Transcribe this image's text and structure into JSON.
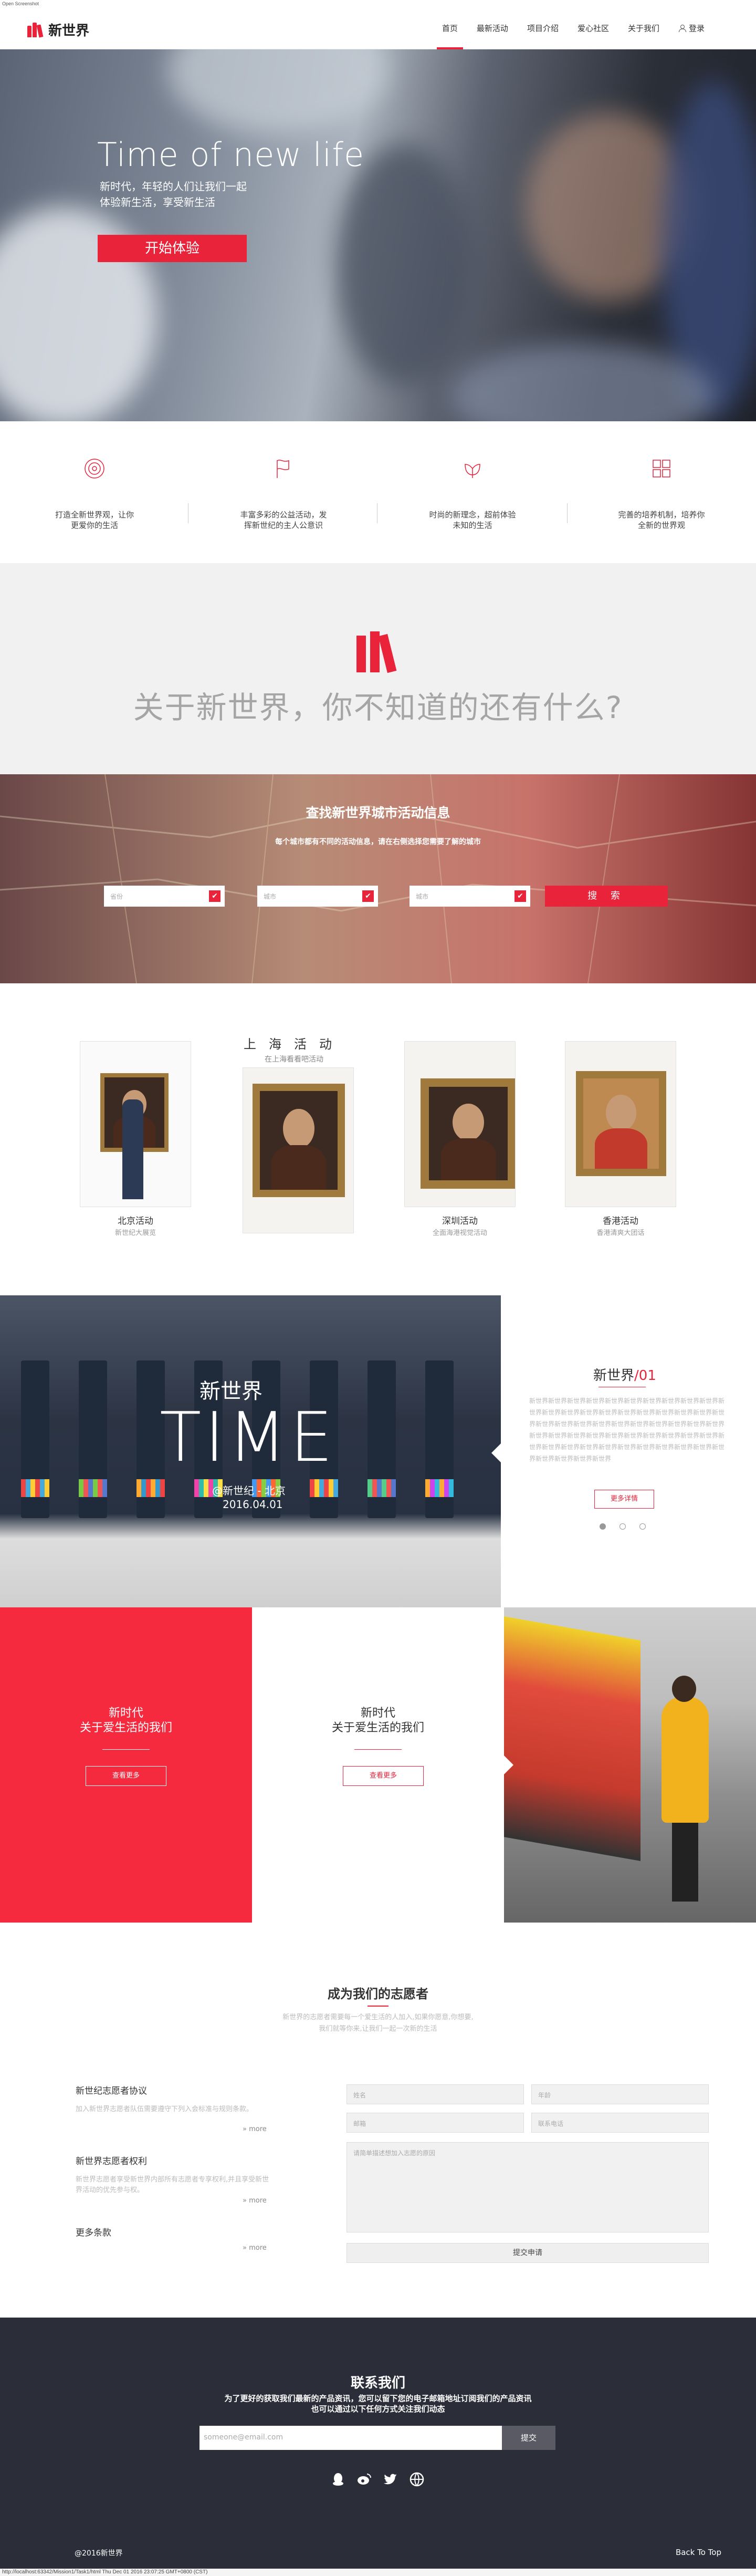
{
  "chrome": {
    "tab_title": "Open Screenshot",
    "status_bar": "http://localhost:63342/Mission1/Task1/html Thu Dec 01 2016 23:07:25 GMT+0800 (CST)"
  },
  "header": {
    "logo": "新世界",
    "nav": [
      "首页",
      "最新活动",
      "项目介绍",
      "爱心社区",
      "关于我们"
    ],
    "active_nav": "首页",
    "login": "登录",
    "accent": "#e8233a"
  },
  "hero": {
    "title": "Time of new life",
    "subtitle_1": "新时代，年轻的人们让我们一起",
    "subtitle_2": "体验新生活，享受新生活",
    "cta": "开始体验"
  },
  "features": [
    {
      "icon": "target-icon",
      "text_1": "打造全新世界观，让你",
      "text_2": "更爱你的生活"
    },
    {
      "icon": "flag-icon",
      "text_1": "丰富多彩的公益活动，发",
      "text_2": "挥新世纪的主人公意识"
    },
    {
      "icon": "lotus-icon",
      "text_1": "时尚的新理念，超前体验",
      "text_2": "未知的生活"
    },
    {
      "icon": "grid-icon",
      "text_1": "完善的培养机制，培养你",
      "text_2": "全新的世界观"
    }
  ],
  "about": {
    "title": "关于新世界，你不知道的还有什么?"
  },
  "search": {
    "title": "查找新世界城市活动信息",
    "subtitle": "每个城市都有不同的活动信息，请在右侧选择您需要了解的城市",
    "selects": [
      "省份",
      "城市",
      "城市"
    ],
    "button": "搜 索"
  },
  "gallery": {
    "featured_title": "上海活动",
    "featured_sub": "在上海看看吧活动",
    "items": [
      {
        "label": "北京活动",
        "sub": "新世纪大展览"
      },
      {
        "label": "深圳活动",
        "sub": "全面海港视觉活动"
      },
      {
        "label": "香港活动",
        "sub": "香港清爽大团话"
      }
    ]
  },
  "time": {
    "overlay_title": "新世界",
    "big": "TIME",
    "location": "@新世纪 - 北京",
    "date": "2016.04.01",
    "side_title": "新世界",
    "side_num": "/01",
    "side_body": "新世界新世界新世界新世界新世界新世界新世界新世界新世界新世界新世界新世界新世界新世界新世界新世界新世界新世界新世界新世界新世界新世界新世界新世界新世界新世界新世界新世界新世界新世界新世界新世界新世界新世界新世界新世界新世界新世界新世界新世界新世界新世界新世界新世界新世界新世界新世界新世界新世界新世界新世界新世界新世界新世界新世界新世界",
    "side_btn": "更多详情"
  },
  "love": {
    "red": {
      "title_1": "新时代",
      "title_2": "关于爱生活的我们",
      "btn": "查看更多"
    },
    "white": {
      "title_1": "新时代",
      "title_2": "关于爱生活的我们",
      "btn": "查看更多"
    }
  },
  "volunteer": {
    "title": "成为我们的志愿者",
    "sub": "新世界的志愿者需要每一个爱生活的人加入,如果你愿意,你想要,\n我们就等你来,让我们一起一次新的生活",
    "blocks": [
      {
        "h": "新世纪志愿者协议",
        "p": "加入新世界志愿者队伍需要遵守下列入会标准与规则条款。",
        "more": "» more"
      },
      {
        "h": "新世界志愿者权利",
        "p": "新世界志愿者享受新世界内部所有志愿者专享权利,并且享受新世界活动的优先参与权。",
        "more": "» more"
      },
      {
        "h": "更多条款",
        "p": "",
        "more": "» more"
      }
    ],
    "fields": {
      "name": "姓名",
      "age": "年龄",
      "email": "邮箱",
      "phone": "联系电话",
      "message": "请简单描述想加入志愿的原因"
    },
    "submit": "提交申请"
  },
  "contact": {
    "title": "联系我们",
    "sub_1": "为了更好的获取我们最新的产品资讯，您可以留下您的电子邮箱地址订阅我们的产品资讯",
    "sub_2": "也可以通过以下任何方式关注我们动态",
    "email_placeholder": "someone@email.com",
    "submit": "提交",
    "social": [
      "qq-icon",
      "weibo-icon",
      "twitter-icon",
      "globe-icon"
    ],
    "copyright": "@2016新世界",
    "back_top": "Back To Top"
  }
}
